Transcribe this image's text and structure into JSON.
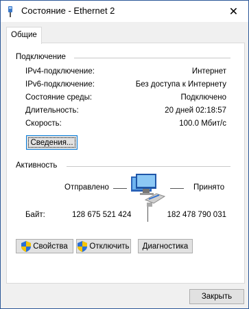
{
  "window": {
    "title": "Состояние - Ethernet 2",
    "close_glyph": "✕",
    "title_icon": "network-connection-icon"
  },
  "tabs": [
    {
      "label": "Общие"
    }
  ],
  "connection": {
    "group_label": "Подключение",
    "rows": [
      {
        "label": "IPv4-подключение:",
        "value": "Интернет"
      },
      {
        "label": "IPv6-подключение:",
        "value": "Без доступа к Интернету"
      },
      {
        "label": "Состояние среды:",
        "value": "Подключено"
      },
      {
        "label": "Длительность:",
        "value": "20 дней 02:18:57"
      },
      {
        "label": "Скорость:",
        "value": "100.0 Мбит/с"
      }
    ],
    "details_button": "Сведения..."
  },
  "activity": {
    "group_label": "Активность",
    "sent_label": "Отправлено",
    "received_label": "Принято",
    "bytes_label": "Байт:",
    "bytes_sent": "128 675 521 424",
    "bytes_received": "182 478 790 031",
    "icon": "network-activity-icon"
  },
  "actions": {
    "properties": "Свойства",
    "disable": "Отключить",
    "diagnose": "Диагностика"
  },
  "footer": {
    "close_button": "Закрыть"
  },
  "colors": {
    "accent": "#0078d7",
    "border": "#2b5797",
    "panel": "#ffffff",
    "background": "#f0f0f0"
  }
}
